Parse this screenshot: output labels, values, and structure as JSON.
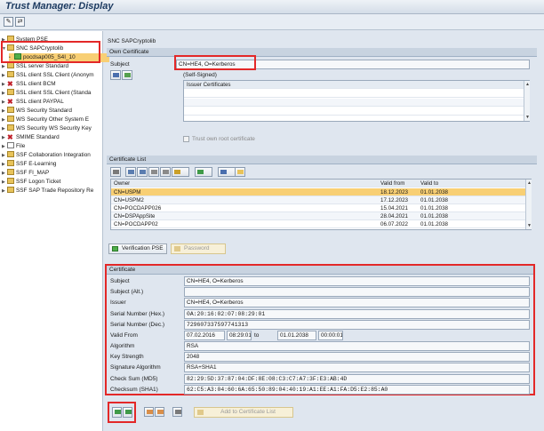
{
  "window": {
    "title": "Trust Manager: Display"
  },
  "toolbar": {
    "icons": [
      "edit-icon",
      "change-icon"
    ]
  },
  "tree": {
    "items": [
      {
        "label": "System PSE",
        "icon": "folder"
      },
      {
        "label": "SNC SAPCryptolib",
        "icon": "folder",
        "expanded": true
      },
      {
        "label": "pocdsap005_S4I_10",
        "icon": "cert",
        "child": true
      },
      {
        "label": "SSL server Standard",
        "icon": "folder"
      },
      {
        "label": "SSL client SSL Client (Anonym",
        "icon": "folder"
      },
      {
        "label": "SSL client BCM",
        "icon": "x"
      },
      {
        "label": "SSL client SSL Client (Standa",
        "icon": "folder"
      },
      {
        "label": "SSL client PAYPAL",
        "icon": "x"
      },
      {
        "label": "WS Security Standard",
        "icon": "folder"
      },
      {
        "label": "WS Security Other System E",
        "icon": "folder"
      },
      {
        "label": "WS Security WS Security Key",
        "icon": "folder"
      },
      {
        "label": "SMIME Standard",
        "icon": "x"
      },
      {
        "label": "File",
        "icon": "file"
      },
      {
        "label": "SSF Collaboration Integration",
        "icon": "folder"
      },
      {
        "label": "SSF E-Learning",
        "icon": "folder"
      },
      {
        "label": "SSF FI_MAP",
        "icon": "folder"
      },
      {
        "label": "SSF Logon Ticket",
        "icon": "folder"
      },
      {
        "label": "SSF SAP Trade Repository Re",
        "icon": "folder"
      }
    ]
  },
  "pse": {
    "header": "SNC SAPCryptolib",
    "own_cert_title": "Own Certificate",
    "subject_label": "Subject",
    "subject_value": "CN=HE4, O=Kerberos",
    "self_signed": "(Self-Signed)",
    "issuer_certs_header": "Issuer Certificates",
    "trust_checkbox_label": "Trust own root certificate"
  },
  "cert_list": {
    "title": "Certificate List",
    "columns": [
      "Owner",
      "Valid from",
      "Valid to"
    ],
    "rows": [
      [
        "CN=USPM",
        "18.12.2023",
        "01.01.2038"
      ],
      [
        "CN=USPM2",
        "17.12.2023",
        "01.01.2038"
      ],
      [
        "CN=POCDAPP026",
        "15.04.2021",
        "01.01.2038"
      ],
      [
        "CN=DSPAppSite",
        "28.04.2021",
        "01.01.2038"
      ],
      [
        "CN=POCDAPP02",
        "06.07.2022",
        "01.01.2038"
      ]
    ],
    "verification_button": "Verification PSE",
    "password_button": "Password"
  },
  "certificate": {
    "title": "Certificate",
    "fields": [
      {
        "label": "Subject",
        "value": "CN=HE4, O=Kerberos"
      },
      {
        "label": "Subject (Alt.)",
        "value": ""
      },
      {
        "label": "Issuer",
        "value": "CN=HE4, O=Kerberos"
      },
      {
        "label": "Serial Number (Hex.)",
        "value": "0A:20:16:02:07:08:29:01"
      },
      {
        "label": "Serial Number (Dec.)",
        "value": "729607337597741313"
      }
    ],
    "valid_from_label": "Valid From",
    "valid_from_date": "07.02.2016",
    "valid_from_time": "08:29:01",
    "to_label": "to",
    "valid_to_date": "01.01.2038",
    "valid_to_time": "00:00:01",
    "fields2": [
      {
        "label": "Algorithm",
        "value": "RSA"
      },
      {
        "label": "Key Strength",
        "value": "2048"
      },
      {
        "label": "Signature Algorithm",
        "value": "RSA+SHA1"
      },
      {
        "label": "Check Sum (MD5)",
        "value": "82:29:5D:37:87:04:DF:8E:08:C3:C7:A7:3F:E3:AB:4D"
      },
      {
        "label": "Checksum (SHA1)",
        "value": "62:C5:A3:04:60:6A:65:50:89:04:40:19:A1:EE:A1:FA:D5:E2:85:A0"
      }
    ],
    "add_button": "Add to Certificate List"
  },
  "colors": {
    "highlight": "#e32828",
    "selected_row": "#f8cf74"
  }
}
